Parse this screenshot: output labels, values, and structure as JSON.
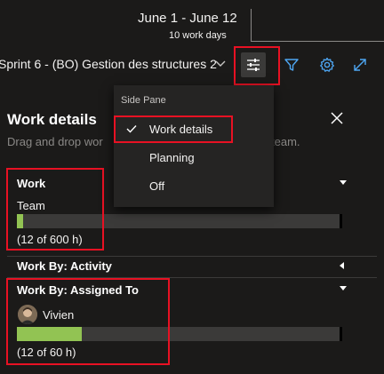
{
  "header": {
    "sprint_dates": "June 1 - June 12",
    "work_days": "10 work days",
    "sprint_name": "Sprint 6 - (BO) Gestion des structures 2"
  },
  "toolbar": {
    "settings_icon": "sliders-icon",
    "filter_icon": "filter-icon",
    "gear_icon": "gear-icon",
    "expand_icon": "expand-icon"
  },
  "side_pane_menu": {
    "header": "Side Pane",
    "items": [
      {
        "label": "Work details",
        "checked": true
      },
      {
        "label": "Planning",
        "checked": false
      },
      {
        "label": "Off",
        "checked": false
      }
    ]
  },
  "panel": {
    "title": "Work details",
    "hint_start": "Drag and drop wor",
    "hint_end": "s your team.",
    "sections": {
      "work": {
        "title": "Work",
        "row_label": "Team",
        "summary": "(12 of 600 h)",
        "progress": 0.02
      },
      "activity": {
        "title": "Work By: Activity"
      },
      "assigned": {
        "title": "Work By: Assigned To",
        "row_label": "Vivien",
        "summary": "(12 of 60 h)",
        "progress": 0.2
      }
    }
  },
  "colors": {
    "background": "#1b1a19",
    "progress_fill": "#92c353",
    "highlight_border": "#e81123",
    "accent_blue": "#4ea6f2"
  }
}
